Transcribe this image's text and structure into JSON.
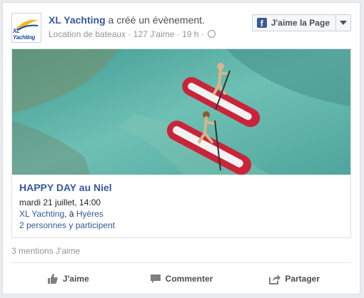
{
  "post": {
    "page_name": "XL Yachting",
    "action_text": "a créé un évènement.",
    "category": "Location de bateaux",
    "likes": "127 J'aime",
    "time": "19 h",
    "like_page_label": "J'aime la Page",
    "logo_text": "XL Yachting"
  },
  "event": {
    "title": "HAPPY DAY au Niel",
    "datetime": "mardi 21 juillet, 14:00",
    "host": "XL Yachting",
    "separator": ", à ",
    "location": "Hyères",
    "participants": "2 personnes y participent"
  },
  "footer": {
    "mentions": "3 mentions J'aime",
    "like_label": "J'aime",
    "comment_label": "Commenter",
    "share_label": "Partager"
  },
  "colors": {
    "link": "#365899",
    "muted": "#90949c",
    "water": "#5fb5ad",
    "board": "#c9243a"
  }
}
